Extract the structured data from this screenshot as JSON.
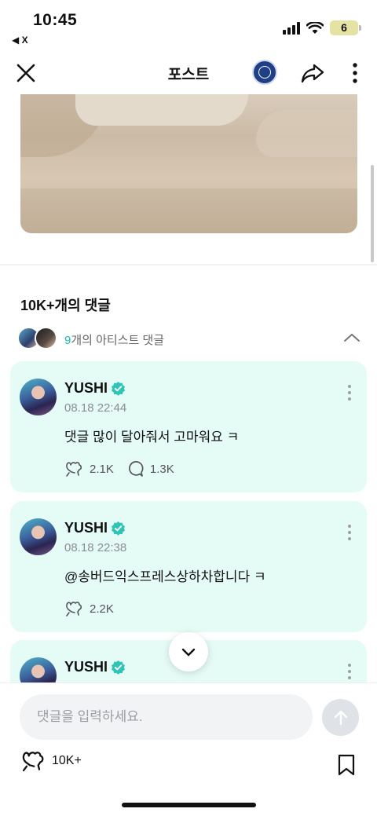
{
  "status_bar": {
    "time": "10:45",
    "back_app": "◀ X",
    "battery": "6"
  },
  "nav": {
    "title": "포스트",
    "icons": [
      "close-icon",
      "community-badge-icon",
      "share-icon",
      "more-vertical-icon"
    ]
  },
  "comments": {
    "count_label": "10K+개의 댓글",
    "artist_count": "9",
    "artist_label_rest": "개의 아티스트 댓글"
  },
  "comment_list": [
    {
      "author": "YUSHI",
      "date": "08.18 22:44",
      "text": "댓글 많이 달아줘서 고마워요 ㅋ",
      "likes": "2.1K",
      "replies": "1.3K"
    },
    {
      "author": "YUSHI",
      "date": "08.18 22:38",
      "text": "@송버드익스프레스상하차합니다 ㅋ",
      "likes": "2.2K"
    },
    {
      "author": "YUSHI"
    }
  ],
  "composer": {
    "placeholder": "댓글을 입력하세요.",
    "like_count": "10K+"
  },
  "colors": {
    "accent": "#1ab8b0",
    "card_background": "#e5fbf6",
    "verified": "#2ec4b6"
  }
}
